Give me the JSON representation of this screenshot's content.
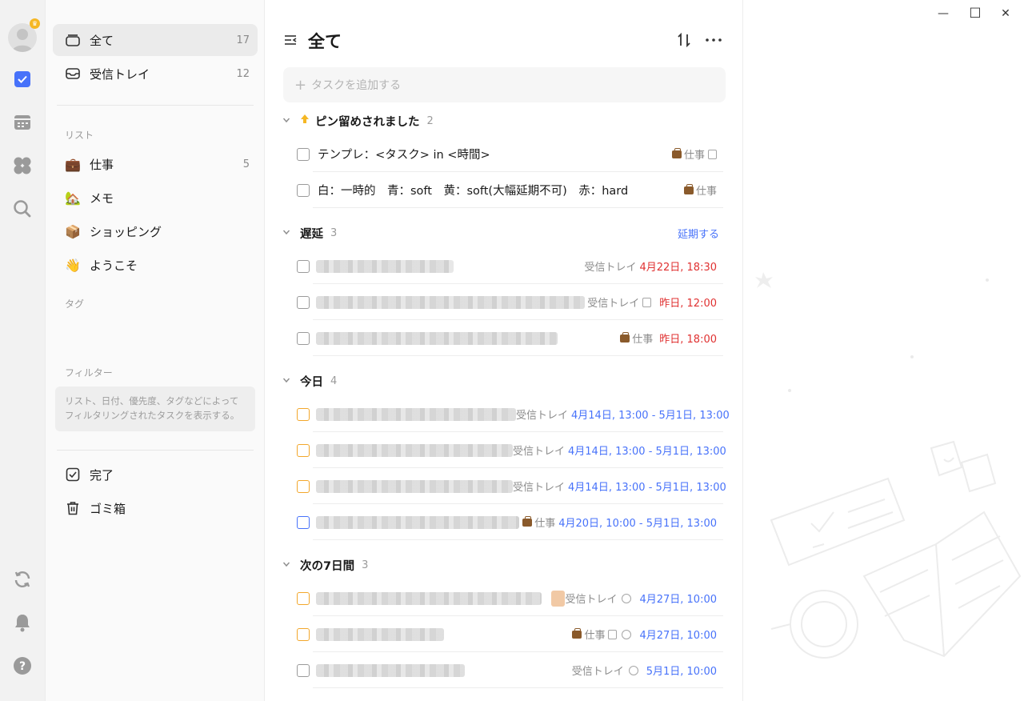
{
  "window": {
    "minimize": "—",
    "maximize": "☐",
    "close": "✕"
  },
  "sidebar": {
    "items": [
      {
        "label": "全て",
        "count": "17"
      },
      {
        "label": "受信トレイ",
        "count": "12"
      }
    ],
    "lists_title": "リスト",
    "lists": [
      {
        "label": "仕事",
        "count": "5",
        "emoji": "💼"
      },
      {
        "label": "メモ",
        "count": "",
        "emoji": "🏡"
      },
      {
        "label": "ショッピング",
        "count": "",
        "emoji": "📦"
      },
      {
        "label": "ようこそ",
        "count": "",
        "emoji": "👋"
      }
    ],
    "tags_title": "タグ",
    "filters_title": "フィルター",
    "filters_hint": "リスト、日付、優先度、タグなどによってフィルタリングされたタスクを表示する。",
    "bottom": [
      {
        "label": "完了"
      },
      {
        "label": "ゴミ箱"
      }
    ]
  },
  "main": {
    "title": "全て",
    "add_placeholder": "タスクを追加する",
    "groups": {
      "pinned": {
        "title": "ピン留めされました",
        "count": "2"
      },
      "overdue": {
        "title": "遅延",
        "count": "3",
        "action": "延期する"
      },
      "today": {
        "title": "今日",
        "count": "4"
      },
      "next7": {
        "title": "次の7日間",
        "count": "3"
      }
    },
    "tasks": {
      "p1": {
        "title": "テンプレ：<タスク> in <時間>",
        "list": "仕事"
      },
      "p2": {
        "title": "白：一時的　青：soft　黄：soft(大幅延期不可)　赤：hard",
        "list": "仕事"
      },
      "o1": {
        "list": "受信トレイ",
        "date": "4月22日, 18:30"
      },
      "o2": {
        "list": "受信トレイ",
        "date": "昨日, 12:00"
      },
      "o3": {
        "list": "仕事",
        "date": "昨日, 18:00"
      },
      "t1": {
        "list": "受信トレイ",
        "date": "4月14日, 13:00 - 5月1日, 13:00"
      },
      "t2": {
        "list": "受信トレイ",
        "date": "4月14日, 13:00 - 5月1日, 13:00"
      },
      "t3": {
        "list": "受信トレイ",
        "date": "4月14日, 13:00 - 5月1日, 13:00"
      },
      "t4": {
        "list": "仕事",
        "date": "4月20日, 10:00 - 5月1日, 13:00"
      },
      "n1": {
        "list": "受信トレイ",
        "date": "4月27日, 10:00"
      },
      "n2": {
        "list": "仕事",
        "date": "4月27日, 10:00"
      },
      "n3": {
        "list": "受信トレイ",
        "date": "5月1日, 10:00"
      }
    }
  }
}
